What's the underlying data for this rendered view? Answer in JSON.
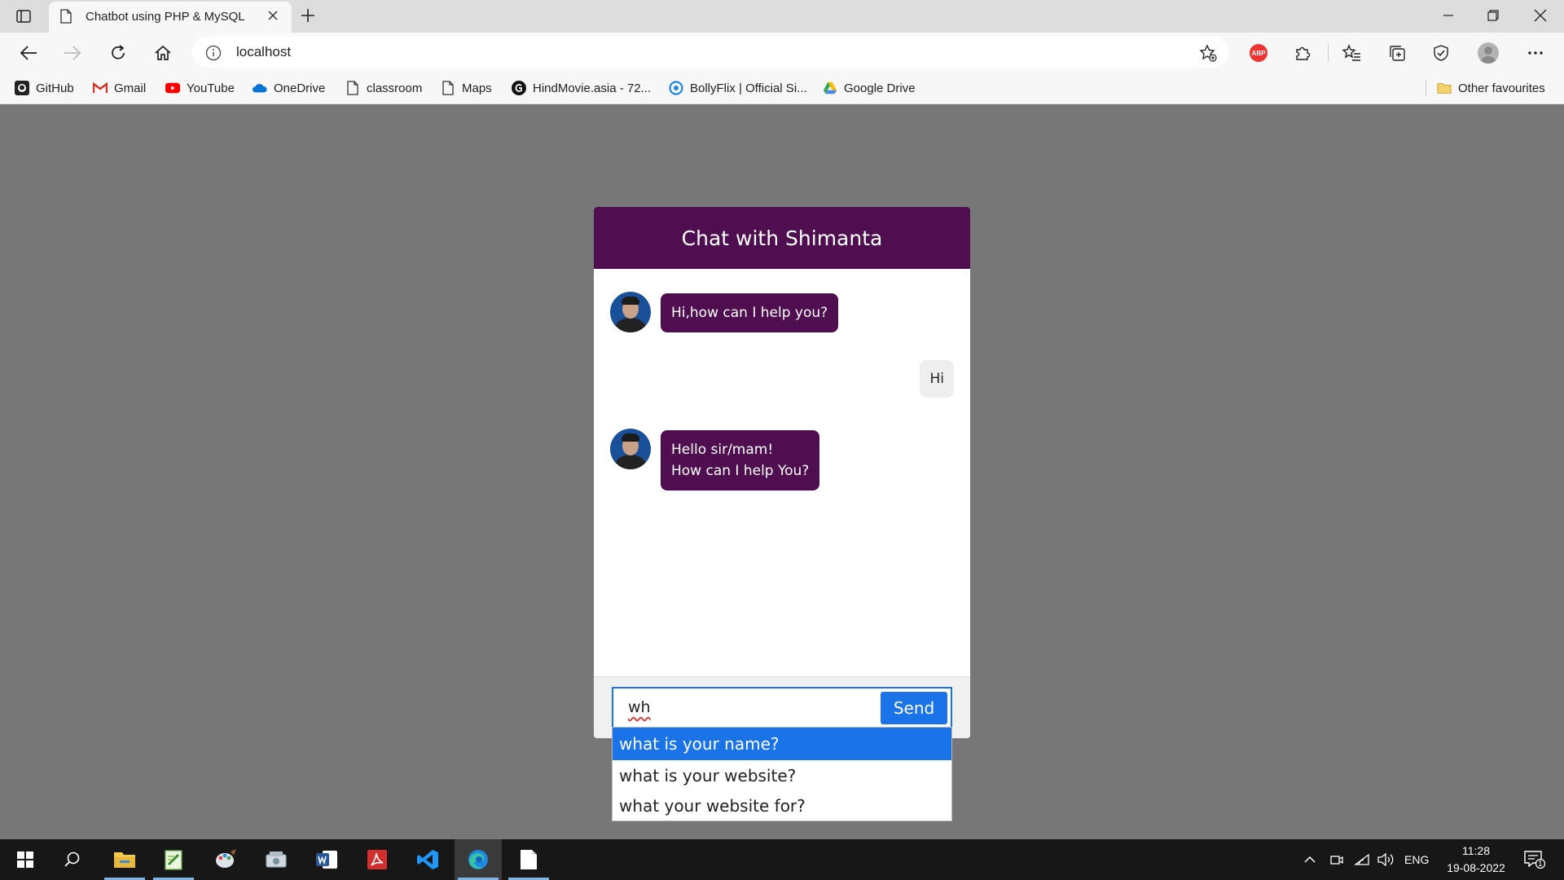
{
  "browser": {
    "tab_title": "Chatbot using PHP & MySQL",
    "url": "localhost",
    "bookmarks": [
      {
        "label": "GitHub",
        "icon": "github-icon"
      },
      {
        "label": "Gmail",
        "icon": "gmail-icon"
      },
      {
        "label": "YouTube",
        "icon": "youtube-icon"
      },
      {
        "label": "OneDrive",
        "icon": "onedrive-icon"
      },
      {
        "label": "classroom",
        "icon": "page-icon"
      },
      {
        "label": "Maps",
        "icon": "page-icon"
      },
      {
        "label": "HindMovie.asia - 72...",
        "icon": "hindmovie-icon"
      },
      {
        "label": "BollyFlix | Official Si...",
        "icon": "bollyflix-icon"
      },
      {
        "label": "Google Drive",
        "icon": "google-drive-icon"
      }
    ],
    "other_favourites": "Other favourites",
    "extension_badge": "ABP"
  },
  "chat": {
    "title": "Chat with Shimanta",
    "messages": [
      {
        "from": "bot",
        "lines": [
          "Hi,how can I help you?"
        ]
      },
      {
        "from": "user",
        "lines": [
          "Hi"
        ]
      },
      {
        "from": "bot",
        "lines": [
          "Hello sir/mam!",
          "How can I help You?"
        ]
      }
    ],
    "input_value": "wh",
    "send_label": "Send",
    "suggestions": [
      "what is your name?",
      "what is your website?",
      "what your website for?"
    ],
    "active_suggestion": 0
  },
  "taskbar": {
    "language": "ENG",
    "time": "11:28",
    "date": "19-08-2022",
    "notification_count": "1"
  },
  "colors": {
    "chat_header": "#4e0e4f",
    "bot_bubble": "#4e0e4f",
    "send_button": "#1a73e8",
    "page_background": "#777777"
  }
}
